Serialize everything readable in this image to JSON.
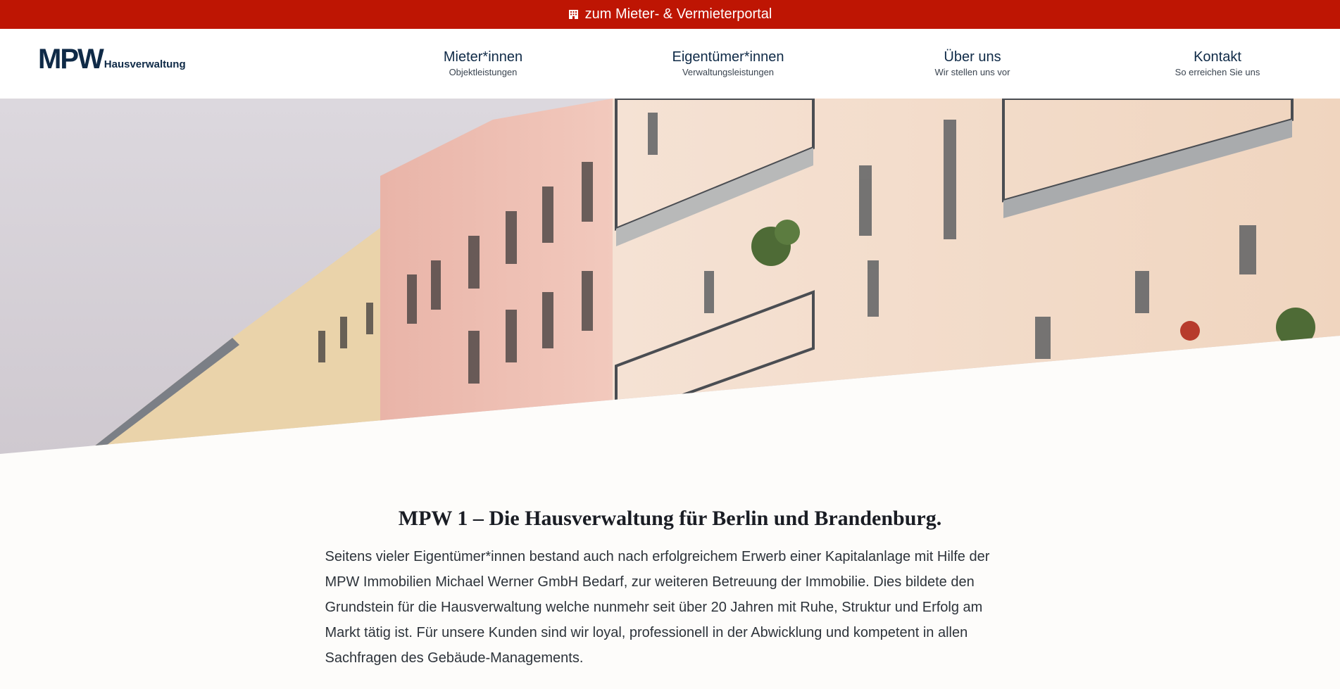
{
  "topbar": {
    "label": "zum Mieter- & Vermieterportal",
    "icon": "building-icon",
    "background": "#be1503"
  },
  "logo": {
    "mark": "MPW",
    "subtitle": "Hausverwaltung",
    "color": "#0f2a47"
  },
  "nav": [
    {
      "title": "Mieter*innen",
      "subtitle": "Objektleistungen"
    },
    {
      "title": "Eigentümer*innen",
      "subtitle": "Verwaltungsleistungen"
    },
    {
      "title": "Über uns",
      "subtitle": "Wir stellen uns vor"
    },
    {
      "title": "Kontakt",
      "subtitle": "So erreichen Sie uns"
    }
  ],
  "main": {
    "heading": "MPW 1 – Die Hausverwaltung für Berlin und Brandenburg.",
    "paragraph": "Seitens vieler Eigentümer*innen bestand auch nach erfolgreichem Erwerb einer Kapitalanlage mit Hilfe der MPW Immobilien Michael Werner GmbH Bedarf, zur weiteren Betreuung der Immobilie. Dies bildete den Grundstein für die Hausverwaltung welche nunmehr seit über 20 Jahren mit Ruhe, Struktur und Erfolg am Markt tätig ist. Für unsere Kunden sind wir loyal, professionell in der Abwicklung und kompetent in allen Sachfragen des Gebäude-Managements."
  }
}
